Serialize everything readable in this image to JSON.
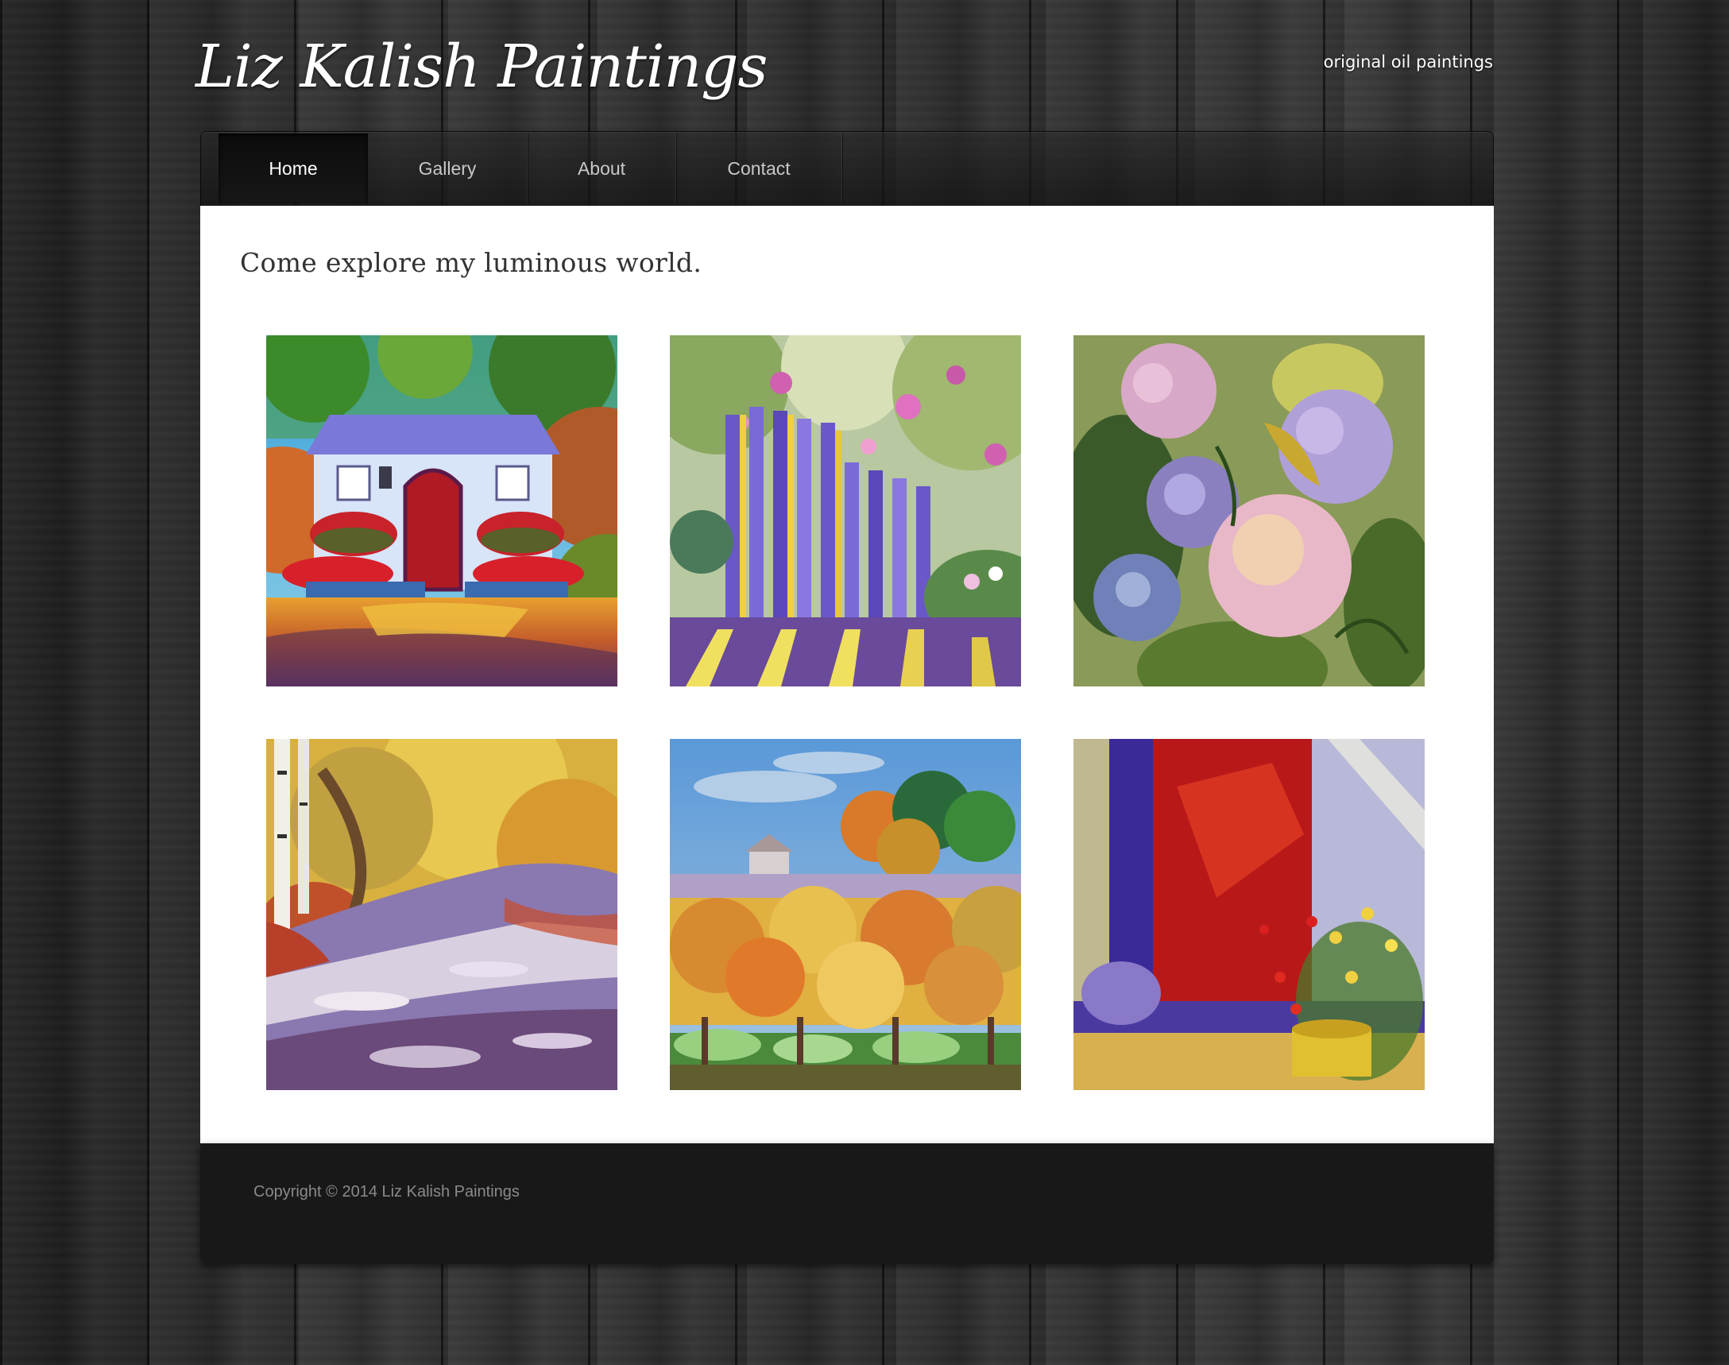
{
  "header": {
    "site_title": "Liz Kalish Paintings",
    "tagline": "original oil paintings"
  },
  "nav": {
    "items": [
      {
        "label": "Home",
        "active": true
      },
      {
        "label": "Gallery",
        "active": false
      },
      {
        "label": "About",
        "active": false
      },
      {
        "label": "Contact",
        "active": false
      }
    ]
  },
  "main": {
    "headline": "Come explore my luminous world.",
    "paintings": [
      {
        "subject": "cottage with red door"
      },
      {
        "subject": "garden gate with roses"
      },
      {
        "subject": "hydrangeas"
      },
      {
        "subject": "autumn stream"
      },
      {
        "subject": "orchard with farmhouse"
      },
      {
        "subject": "red door with flowers"
      }
    ]
  },
  "footer": {
    "copyright": "Copyright © 2014 Liz Kalish Paintings"
  },
  "colors": {
    "content_background": "#ffffff",
    "footer_background": "#181818",
    "nav_text": "#c8c8c8",
    "nav_active_text": "#ffffff",
    "headline_text": "#333333"
  }
}
